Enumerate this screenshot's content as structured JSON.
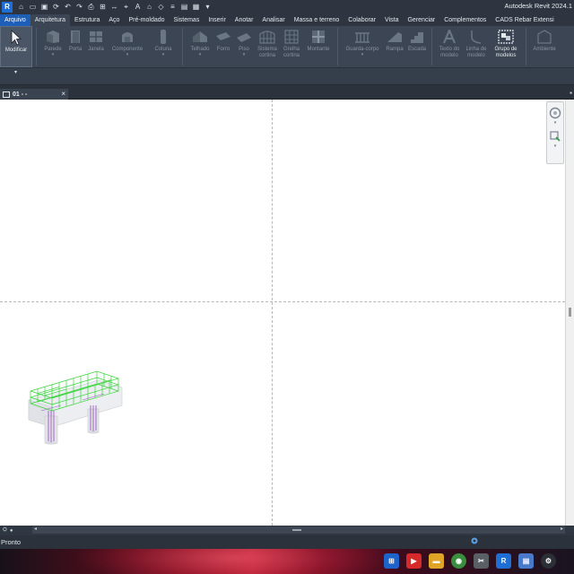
{
  "app": {
    "title": "Autodesk Revit 2024.1",
    "logo_letter": "R"
  },
  "quick_access": {
    "icons": [
      "home-icon",
      "open-icon",
      "save-icon",
      "sync-icon",
      "undo-icon",
      "redo-icon",
      "print-icon",
      "measure-icon",
      "dimension-icon",
      "tag-icon",
      "text-icon",
      "3d-view-icon",
      "section-icon",
      "thin-lines-icon",
      "close-hidden-icon",
      "switch-windows-icon",
      "customize-icon"
    ]
  },
  "ribbon_tabs": [
    {
      "label": "Arquivo",
      "state": "file"
    },
    {
      "label": "Arquitetura",
      "state": "active"
    },
    {
      "label": "Estrutura",
      "state": ""
    },
    {
      "label": "Aço",
      "state": ""
    },
    {
      "label": "Pré-moldado",
      "state": ""
    },
    {
      "label": "Sistemas",
      "state": ""
    },
    {
      "label": "Inserir",
      "state": ""
    },
    {
      "label": "Anotar",
      "state": ""
    },
    {
      "label": "Analisar",
      "state": ""
    },
    {
      "label": "Massa e terreno",
      "state": ""
    },
    {
      "label": "Colaborar",
      "state": ""
    },
    {
      "label": "Vista",
      "state": ""
    },
    {
      "label": "Gerenciar",
      "state": ""
    },
    {
      "label": "Complementos",
      "state": ""
    },
    {
      "label": "CADS Rebar Extensi",
      "state": ""
    }
  ],
  "tools": {
    "modificar": "Modificar",
    "parede": "Parede",
    "porta": "Porta",
    "janela": "Janela",
    "componente": "Componente",
    "coluna": "Coluna",
    "telhado": "Telhado",
    "forro": "Forro",
    "piso": "Piso",
    "sistema_cortina_1": "Sistema",
    "sistema_cortina_2": "cortina",
    "grelha_cortina_1": "Grelha",
    "grelha_cortina_2": "cortina",
    "montante": "Montante",
    "guarda_corpo": "Guarda-corpo",
    "rampa": "Rampa",
    "escada": "Escada",
    "texto_modelo_1": "Texto do",
    "texto_modelo_2": "modelo",
    "linha_modelo_1": "Linha de",
    "linha_modelo_2": "modelo",
    "grupo_modelos_1": "Grupo de",
    "grupo_modelos_2": "modelos",
    "ambiente": "Ambiente"
  },
  "view_tab": {
    "name": "01 - -",
    "close": "×"
  },
  "status_bar": {
    "text": "Pronto"
  },
  "colors": {
    "accent": "#1d5fb8",
    "ribbon_bg": "#3b4553",
    "canvas_bg": "#ffffff",
    "rebar_green": "#39d43a",
    "rebar_purple": "#9b5cc0"
  }
}
